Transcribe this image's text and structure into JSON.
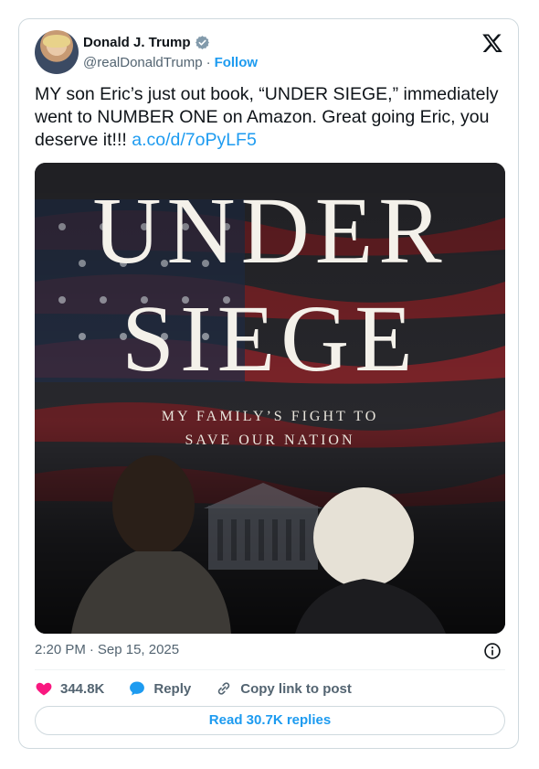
{
  "author": {
    "name": "Donald J. Trump",
    "handle": "@realDonaldTrump",
    "separator": "·",
    "follow_label": "Follow"
  },
  "tweet": {
    "text": "MY son Eric’s just out book, “UNDER SIEGE,” immediately went to NUMBER ONE on Amazon. Great going Eric, you deserve it!!! ",
    "link": "a.co/d/7oPyLF5"
  },
  "media": {
    "title_line1": "UNDER",
    "title_line2": "SIEGE",
    "subtitle_line1": "MY FAMILY’S FIGHT TO",
    "subtitle_line2": "SAVE OUR NATION"
  },
  "meta": {
    "time": "2:20 PM",
    "separator": "·",
    "date": "Sep 15, 2025"
  },
  "actions": {
    "likes": "344.8K",
    "reply_label": "Reply",
    "copy_label": "Copy link to post"
  },
  "read_replies_label": "Read 30.7K replies",
  "colors": {
    "accent": "#1d9bf0",
    "like": "#f91880",
    "muted": "#536471",
    "border": "#cfd9de"
  },
  "icons": [
    "verified-badge-icon",
    "x-logo-icon",
    "info-icon",
    "heart-icon",
    "reply-bubble-icon",
    "link-icon"
  ]
}
